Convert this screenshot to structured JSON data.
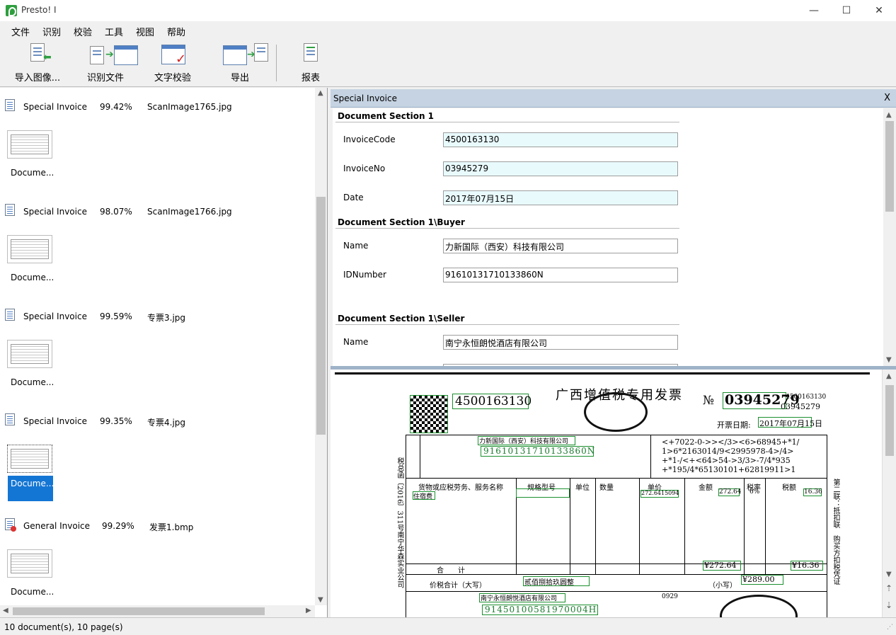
{
  "window": {
    "title": "Presto! I",
    "minimize": "—",
    "maximize": "☐",
    "close": "✕"
  },
  "menu": [
    "文件",
    "识别",
    "校验",
    "工具",
    "视图",
    "帮助"
  ],
  "toolbar": {
    "import": "导入图像...",
    "recognize": "识别文件",
    "verify": "文字校验",
    "export": "导出",
    "report": "报表"
  },
  "documents": [
    {
      "type": "Special Invoice",
      "confidence": "99.42%",
      "file": "ScanImage1765.jpg",
      "label": "Docume..."
    },
    {
      "type": "Special Invoice",
      "confidence": "98.07%",
      "file": "ScanImage1766.jpg",
      "label": "Docume..."
    },
    {
      "type": "Special Invoice",
      "confidence": "99.59%",
      "file": "专票3.jpg",
      "label": "Docume..."
    },
    {
      "type": "Special Invoice",
      "confidence": "99.35%",
      "file": "专票4.jpg",
      "label": "Docume..."
    },
    {
      "type": "General Invoice",
      "confidence": "99.29%",
      "file": "发票1.bmp",
      "label": "Docume..."
    }
  ],
  "form": {
    "title": "Special Invoice",
    "close": "X",
    "section1": {
      "title": "Document Section 1",
      "fields": [
        {
          "label": "InvoiceCode",
          "value": "4500163130"
        },
        {
          "label": "InvoiceNo",
          "value": "03945279"
        },
        {
          "label": "Date",
          "value": "2017年07月15日"
        }
      ]
    },
    "buyer": {
      "title": "Document Section 1\\Buyer",
      "fields": [
        {
          "label": "Name",
          "value": "力新国际（西安）科技有限公司"
        },
        {
          "label": "IDNumber",
          "value": "91610131710133860N"
        }
      ]
    },
    "seller": {
      "title": "Document Section 1\\Seller",
      "fields": [
        {
          "label": "Name",
          "value": "南宁永恒朗悦酒店有限公司"
        }
      ]
    }
  },
  "invoice_image": {
    "title": "广西增值税专用发票",
    "no_mark": "№",
    "number": "03945279",
    "code": "4500163130",
    "code_small": "4500163130",
    "number_small": "03945279",
    "date_label": "开票日期:",
    "date": "2017年07月15日",
    "buyer_name": "力新国际（西安）科技有限公司",
    "buyer_id": "91610131710133860N",
    "cipher": [
      "<+7022-0->></3><6>68945+*1/",
      "1>6*2163014/9<2995978-4>/4>",
      "+*1-/<+<64>54->3/3>-7/4*935",
      "+*195/4*65130101+62819911>1"
    ],
    "item": "住宿费",
    "unit_price": "272.6415094",
    "amount": "272.64",
    "tax_rate": "6%",
    "tax": "16.36",
    "total_amount": "¥272.64",
    "total_tax": "¥16.36",
    "grand_total_label": "价税合计（大写）",
    "grand_total_words": "贰佰捌拾玖圆整",
    "small_label": "（小写）",
    "grand_total": "¥289.00",
    "seller_name": "南宁永恒朗悦酒店有限公司",
    "seller_id": "91450100581970004H",
    "headers": [
      "货物或应税劳务、服务名称",
      "规格型号",
      "单位",
      "数量",
      "单价",
      "金额",
      "税率",
      "税额"
    ],
    "sum_label": "合　　计",
    "side_left": "税总函〔2016〕311号南宁华森实业公司",
    "side_right": "第二联：抵扣联　购买方扣税凭证",
    "remark_code": "0929"
  },
  "status": "10 document(s), 10 page(s)"
}
